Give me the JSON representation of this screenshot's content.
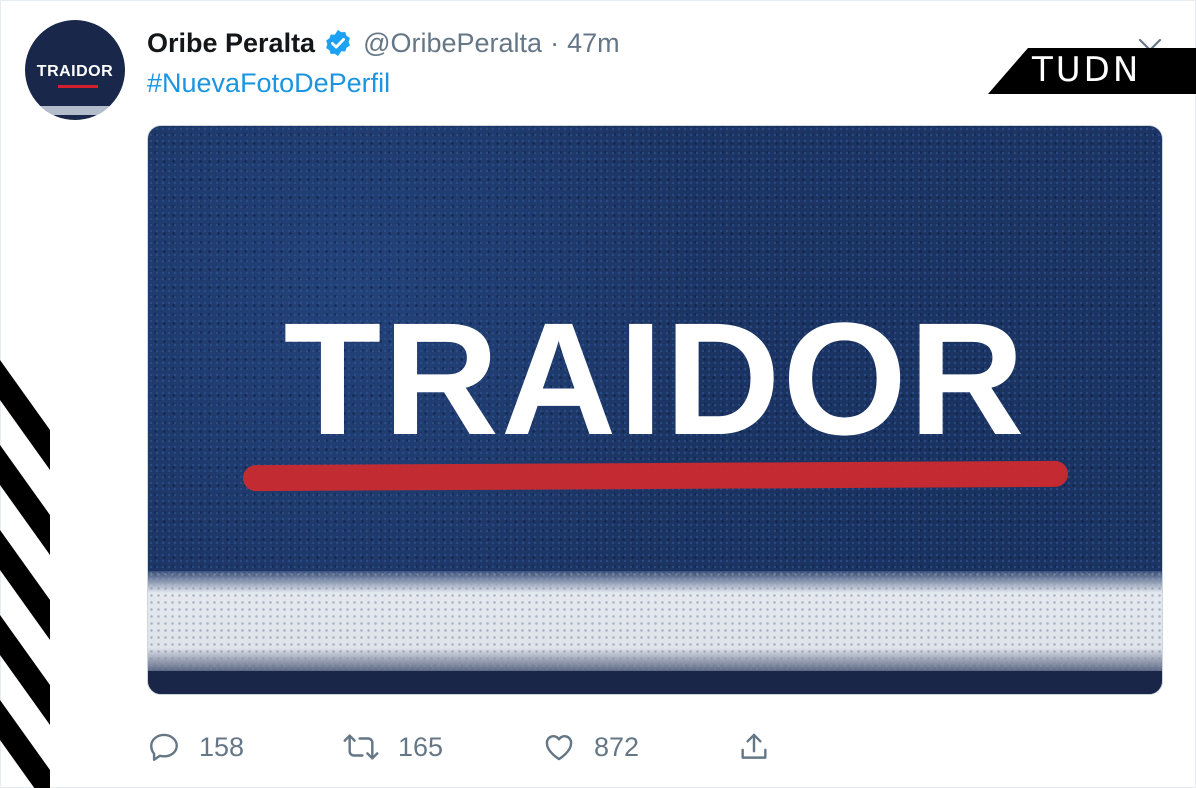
{
  "tweet": {
    "author_name": "Oribe Peralta",
    "handle": "@OribePeralta",
    "separator": "·",
    "time": "47m",
    "hashtag": "#NuevaFotoDePerfil",
    "avatar_text": "TRAIDOR",
    "media_text": "TRAIDOR"
  },
  "actions": {
    "reply_count": "158",
    "retweet_count": "165",
    "like_count": "872"
  },
  "watermark": {
    "text": "TUDN"
  },
  "colors": {
    "link": "#1b95e0",
    "verified": "#1da1f2",
    "muted": "#657786",
    "media_blue": "#1c3463",
    "red_line": "#cc2a2f"
  },
  "icons": [
    "verified-badge-icon",
    "chevron-down-icon",
    "reply-icon",
    "retweet-icon",
    "like-icon",
    "share-icon"
  ]
}
